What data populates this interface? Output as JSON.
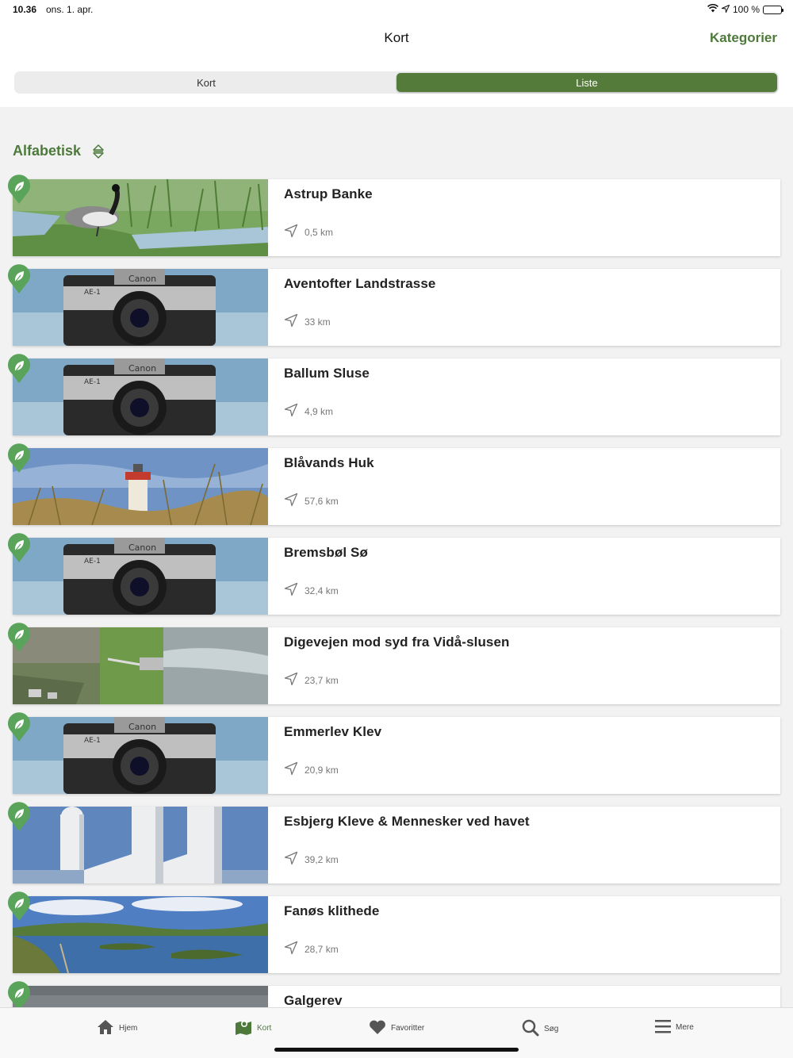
{
  "status": {
    "time": "10.36",
    "date": "ons. 1. apr.",
    "battery": "100 %"
  },
  "nav": {
    "title": "Kort",
    "action": "Kategorier"
  },
  "segments": [
    {
      "label": "Kort",
      "active": false
    },
    {
      "label": "Liste",
      "active": true
    }
  ],
  "sort": {
    "label": "Alfabetisk"
  },
  "places": [
    {
      "name": "Astrup Banke",
      "distance": "0,5 km",
      "image": "goose-meadow"
    },
    {
      "name": "Aventofter Landstrasse",
      "distance": "33 km",
      "image": "camera-placeholder"
    },
    {
      "name": "Ballum Sluse",
      "distance": "4,9 km",
      "image": "camera-placeholder"
    },
    {
      "name": "Blåvands Huk",
      "distance": "57,6 km",
      "image": "lighthouse-dune"
    },
    {
      "name": "Bremsbøl Sø",
      "distance": "32,4 km",
      "image": "camera-placeholder"
    },
    {
      "name": "Digevejen mod syd fra Vidå-slusen",
      "distance": "23,7 km",
      "image": "aerial-dike"
    },
    {
      "name": "Emmerlev Klev",
      "distance": "20,9 km",
      "image": "camera-placeholder"
    },
    {
      "name": "Esbjerg Kleve & Mennesker ved havet",
      "distance": "39,2 km",
      "image": "white-statues"
    },
    {
      "name": "Fanøs klithede",
      "distance": "28,7 km",
      "image": "heath-lake"
    },
    {
      "name": "Galgerev",
      "distance": "",
      "image": "grey-sky"
    }
  ],
  "tabs": [
    {
      "label": "Hjem",
      "icon": "home-icon",
      "active": false
    },
    {
      "label": "Kort",
      "icon": "map-icon",
      "active": true
    },
    {
      "label": "Favoritter",
      "icon": "heart-icon",
      "active": false
    },
    {
      "label": "Søg",
      "icon": "search-icon",
      "active": false
    },
    {
      "label": "Mere",
      "icon": "menu-icon",
      "active": false
    }
  ],
  "colors": {
    "accent": "#557b3b",
    "accent_text": "#4d7a3a",
    "pin": "#5aa35a"
  }
}
